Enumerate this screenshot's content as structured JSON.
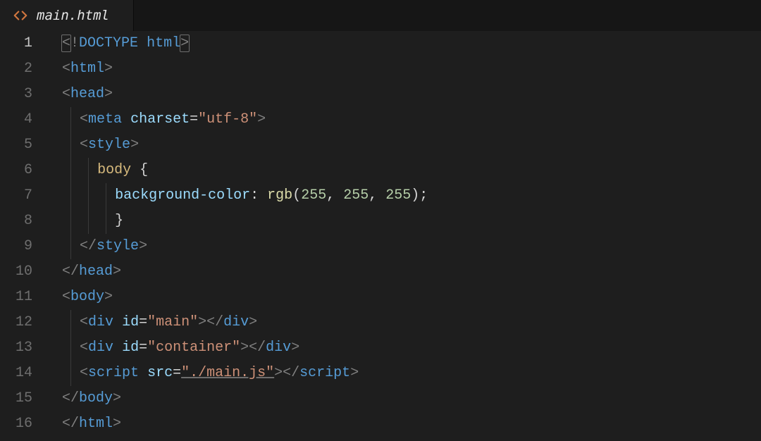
{
  "tab": {
    "title": "main.html",
    "iconName": "code-icon"
  },
  "editor": {
    "lineCount": 16,
    "activeLine": 1,
    "lines": {
      "1": {
        "indent": 0,
        "tokens": [
          {
            "t": "<",
            "c": "punct",
            "box": true
          },
          {
            "t": "!",
            "c": "punct"
          },
          {
            "t": "DOCTYPE",
            "c": "tag"
          },
          {
            "t": " ",
            "c": "text"
          },
          {
            "t": "html",
            "c": "doctype-kw"
          },
          {
            "t": ">",
            "c": "punct",
            "box": true
          }
        ]
      },
      "2": {
        "indent": 0,
        "tokens": [
          {
            "t": "<",
            "c": "punct"
          },
          {
            "t": "html",
            "c": "tag"
          },
          {
            "t": ">",
            "c": "punct"
          }
        ]
      },
      "3": {
        "indent": 0,
        "tokens": [
          {
            "t": "<",
            "c": "punct"
          },
          {
            "t": "head",
            "c": "tag"
          },
          {
            "t": ">",
            "c": "punct"
          }
        ]
      },
      "4": {
        "indent": 1,
        "tokens": [
          {
            "t": "<",
            "c": "punct"
          },
          {
            "t": "meta",
            "c": "tag"
          },
          {
            "t": " ",
            "c": "text"
          },
          {
            "t": "charset",
            "c": "attr"
          },
          {
            "t": "=",
            "c": "eq"
          },
          {
            "t": "\"utf-8\"",
            "c": "string"
          },
          {
            "t": ">",
            "c": "punct"
          }
        ]
      },
      "5": {
        "indent": 1,
        "tokens": [
          {
            "t": "<",
            "c": "punct"
          },
          {
            "t": "style",
            "c": "tag"
          },
          {
            "t": ">",
            "c": "punct"
          }
        ]
      },
      "6": {
        "indent": 2,
        "tokens": [
          {
            "t": "body",
            "c": "sel"
          },
          {
            "t": " ",
            "c": "text"
          },
          {
            "t": "{",
            "c": "brace"
          }
        ]
      },
      "7": {
        "indent": 3,
        "tokens": [
          {
            "t": "background-color",
            "c": "prop"
          },
          {
            "t": ":",
            "c": "colon"
          },
          {
            "t": " ",
            "c": "text"
          },
          {
            "t": "rgb",
            "c": "func"
          },
          {
            "t": "(",
            "c": "brace"
          },
          {
            "t": "255",
            "c": "num"
          },
          {
            "t": ", ",
            "c": "text"
          },
          {
            "t": "255",
            "c": "num"
          },
          {
            "t": ", ",
            "c": "text"
          },
          {
            "t": "255",
            "c": "num"
          },
          {
            "t": ")",
            "c": "brace"
          },
          {
            "t": ";",
            "c": "semi"
          }
        ]
      },
      "8": {
        "indent": 3,
        "tokens": [
          {
            "t": "}",
            "c": "brace"
          }
        ]
      },
      "9": {
        "indent": 1,
        "tokens": [
          {
            "t": "</",
            "c": "punct"
          },
          {
            "t": "style",
            "c": "tag"
          },
          {
            "t": ">",
            "c": "punct"
          }
        ]
      },
      "10": {
        "indent": 0,
        "tokens": [
          {
            "t": "</",
            "c": "punct"
          },
          {
            "t": "head",
            "c": "tag"
          },
          {
            "t": ">",
            "c": "punct"
          }
        ]
      },
      "11": {
        "indent": 0,
        "tokens": [
          {
            "t": "<",
            "c": "punct"
          },
          {
            "t": "body",
            "c": "tag"
          },
          {
            "t": ">",
            "c": "punct"
          }
        ]
      },
      "12": {
        "indent": 1,
        "tokens": [
          {
            "t": "<",
            "c": "punct"
          },
          {
            "t": "div",
            "c": "tag"
          },
          {
            "t": " ",
            "c": "text"
          },
          {
            "t": "id",
            "c": "attr"
          },
          {
            "t": "=",
            "c": "eq"
          },
          {
            "t": "\"main\"",
            "c": "string"
          },
          {
            "t": ">",
            "c": "punct"
          },
          {
            "t": "</",
            "c": "punct"
          },
          {
            "t": "div",
            "c": "tag"
          },
          {
            "t": ">",
            "c": "punct"
          }
        ]
      },
      "13": {
        "indent": 1,
        "tokens": [
          {
            "t": "<",
            "c": "punct"
          },
          {
            "t": "div",
            "c": "tag"
          },
          {
            "t": " ",
            "c": "text"
          },
          {
            "t": "id",
            "c": "attr"
          },
          {
            "t": "=",
            "c": "eq"
          },
          {
            "t": "\"container\"",
            "c": "string"
          },
          {
            "t": ">",
            "c": "punct"
          },
          {
            "t": "</",
            "c": "punct"
          },
          {
            "t": "div",
            "c": "tag"
          },
          {
            "t": ">",
            "c": "punct"
          }
        ]
      },
      "14": {
        "indent": 1,
        "tokens": [
          {
            "t": "<",
            "c": "punct"
          },
          {
            "t": "script",
            "c": "tag"
          },
          {
            "t": " ",
            "c": "text"
          },
          {
            "t": "src",
            "c": "attr"
          },
          {
            "t": "=",
            "c": "eq"
          },
          {
            "t": "\"./main.js\"",
            "c": "string",
            "ul": true
          },
          {
            "t": ">",
            "c": "punct"
          },
          {
            "t": "</",
            "c": "punct"
          },
          {
            "t": "script",
            "c": "tag"
          },
          {
            "t": ">",
            "c": "punct"
          }
        ]
      },
      "15": {
        "indent": 0,
        "tokens": [
          {
            "t": "</",
            "c": "punct"
          },
          {
            "t": "body",
            "c": "tag"
          },
          {
            "t": ">",
            "c": "punct"
          }
        ]
      },
      "16": {
        "indent": 0,
        "tokens": [
          {
            "t": "</",
            "c": "punct"
          },
          {
            "t": "html",
            "c": "tag"
          },
          {
            "t": ">",
            "c": "punct"
          }
        ]
      }
    }
  }
}
